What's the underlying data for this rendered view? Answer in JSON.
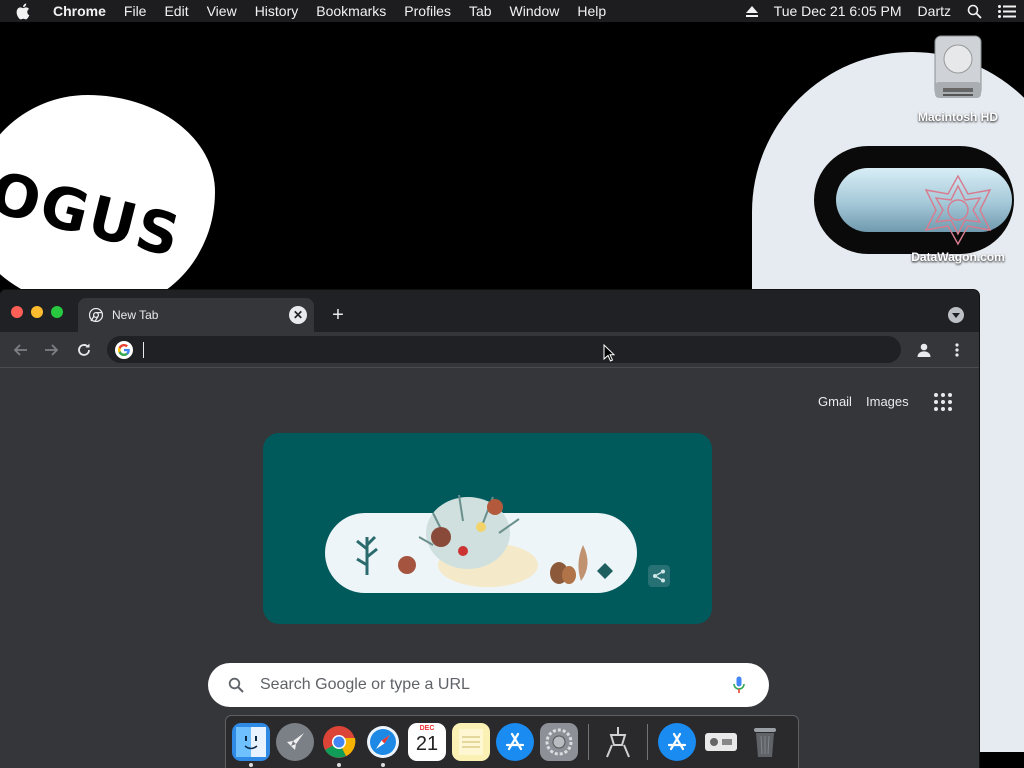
{
  "menubar": {
    "app_name": "Chrome",
    "items": [
      "File",
      "Edit",
      "View",
      "History",
      "Bookmarks",
      "Profiles",
      "Tab",
      "Window",
      "Help"
    ],
    "clock": "Tue Dec 21  6:05 PM",
    "user": "Dartz"
  },
  "desktop": {
    "icons": [
      {
        "label": "Macintosh HD",
        "icon": "hard-drive-icon"
      },
      {
        "label": "DataWagon.com",
        "icon": "datawagon-icon"
      }
    ],
    "wallpaper_text": "OGUS"
  },
  "browser": {
    "tab": {
      "title": "New Tab"
    },
    "omnibox_value": "",
    "toplinks": {
      "gmail": "Gmail",
      "images": "Images"
    },
    "search_placeholder": "Search Google or type a URL",
    "colors": {
      "frame": "#202124",
      "toolbar": "#35363a",
      "doodle_bg": "#005a5c"
    }
  },
  "dock": {
    "items": [
      {
        "name": "Finder",
        "running": true
      },
      {
        "name": "Launchpad",
        "running": false
      },
      {
        "name": "Google Chrome",
        "running": true
      },
      {
        "name": "Safari",
        "running": true
      },
      {
        "name": "Calendar",
        "running": false,
        "month": "DEC",
        "day": "21"
      },
      {
        "name": "Notes",
        "running": false
      },
      {
        "name": "App Store",
        "running": false
      },
      {
        "name": "System Preferences",
        "running": false
      },
      {
        "name": "Utility",
        "running": false
      },
      {
        "name": "App Store",
        "running": false
      },
      {
        "name": "Preview",
        "running": false
      },
      {
        "name": "Trash",
        "running": false
      }
    ]
  }
}
